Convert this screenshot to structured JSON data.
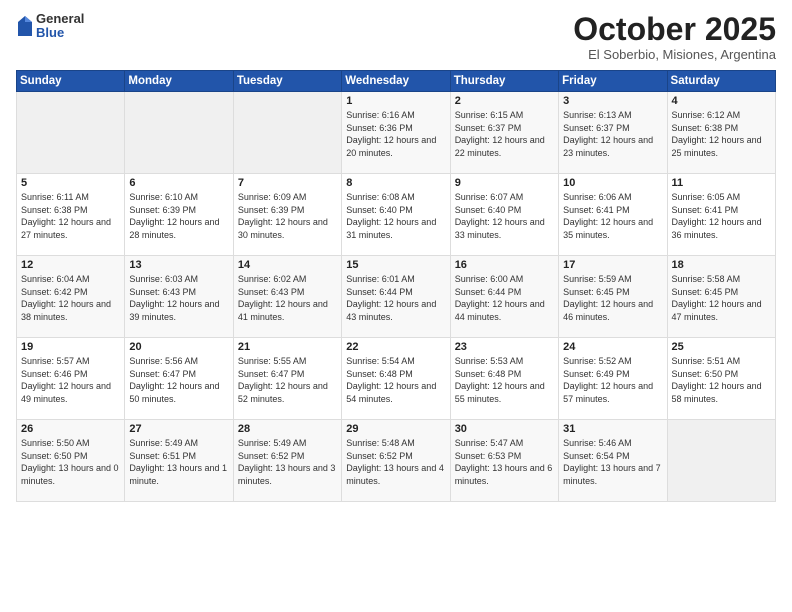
{
  "logo": {
    "general": "General",
    "blue": "Blue"
  },
  "header": {
    "month": "October 2025",
    "location": "El Soberbio, Misiones, Argentina"
  },
  "weekdays": [
    "Sunday",
    "Monday",
    "Tuesday",
    "Wednesday",
    "Thursday",
    "Friday",
    "Saturday"
  ],
  "weeks": [
    [
      {
        "day": "",
        "empty": true
      },
      {
        "day": "",
        "empty": true
      },
      {
        "day": "",
        "empty": true
      },
      {
        "day": "1",
        "sunrise": "6:16 AM",
        "sunset": "6:36 PM",
        "daylight": "12 hours and 20 minutes."
      },
      {
        "day": "2",
        "sunrise": "6:15 AM",
        "sunset": "6:37 PM",
        "daylight": "12 hours and 22 minutes."
      },
      {
        "day": "3",
        "sunrise": "6:13 AM",
        "sunset": "6:37 PM",
        "daylight": "12 hours and 23 minutes."
      },
      {
        "day": "4",
        "sunrise": "6:12 AM",
        "sunset": "6:38 PM",
        "daylight": "12 hours and 25 minutes."
      }
    ],
    [
      {
        "day": "5",
        "sunrise": "6:11 AM",
        "sunset": "6:38 PM",
        "daylight": "12 hours and 27 minutes."
      },
      {
        "day": "6",
        "sunrise": "6:10 AM",
        "sunset": "6:39 PM",
        "daylight": "12 hours and 28 minutes."
      },
      {
        "day": "7",
        "sunrise": "6:09 AM",
        "sunset": "6:39 PM",
        "daylight": "12 hours and 30 minutes."
      },
      {
        "day": "8",
        "sunrise": "6:08 AM",
        "sunset": "6:40 PM",
        "daylight": "12 hours and 31 minutes."
      },
      {
        "day": "9",
        "sunrise": "6:07 AM",
        "sunset": "6:40 PM",
        "daylight": "12 hours and 33 minutes."
      },
      {
        "day": "10",
        "sunrise": "6:06 AM",
        "sunset": "6:41 PM",
        "daylight": "12 hours and 35 minutes."
      },
      {
        "day": "11",
        "sunrise": "6:05 AM",
        "sunset": "6:41 PM",
        "daylight": "12 hours and 36 minutes."
      }
    ],
    [
      {
        "day": "12",
        "sunrise": "6:04 AM",
        "sunset": "6:42 PM",
        "daylight": "12 hours and 38 minutes."
      },
      {
        "day": "13",
        "sunrise": "6:03 AM",
        "sunset": "6:43 PM",
        "daylight": "12 hours and 39 minutes."
      },
      {
        "day": "14",
        "sunrise": "6:02 AM",
        "sunset": "6:43 PM",
        "daylight": "12 hours and 41 minutes."
      },
      {
        "day": "15",
        "sunrise": "6:01 AM",
        "sunset": "6:44 PM",
        "daylight": "12 hours and 43 minutes."
      },
      {
        "day": "16",
        "sunrise": "6:00 AM",
        "sunset": "6:44 PM",
        "daylight": "12 hours and 44 minutes."
      },
      {
        "day": "17",
        "sunrise": "5:59 AM",
        "sunset": "6:45 PM",
        "daylight": "12 hours and 46 minutes."
      },
      {
        "day": "18",
        "sunrise": "5:58 AM",
        "sunset": "6:45 PM",
        "daylight": "12 hours and 47 minutes."
      }
    ],
    [
      {
        "day": "19",
        "sunrise": "5:57 AM",
        "sunset": "6:46 PM",
        "daylight": "12 hours and 49 minutes."
      },
      {
        "day": "20",
        "sunrise": "5:56 AM",
        "sunset": "6:47 PM",
        "daylight": "12 hours and 50 minutes."
      },
      {
        "day": "21",
        "sunrise": "5:55 AM",
        "sunset": "6:47 PM",
        "daylight": "12 hours and 52 minutes."
      },
      {
        "day": "22",
        "sunrise": "5:54 AM",
        "sunset": "6:48 PM",
        "daylight": "12 hours and 54 minutes."
      },
      {
        "day": "23",
        "sunrise": "5:53 AM",
        "sunset": "6:48 PM",
        "daylight": "12 hours and 55 minutes."
      },
      {
        "day": "24",
        "sunrise": "5:52 AM",
        "sunset": "6:49 PM",
        "daylight": "12 hours and 57 minutes."
      },
      {
        "day": "25",
        "sunrise": "5:51 AM",
        "sunset": "6:50 PM",
        "daylight": "12 hours and 58 minutes."
      }
    ],
    [
      {
        "day": "26",
        "sunrise": "5:50 AM",
        "sunset": "6:50 PM",
        "daylight": "13 hours and 0 minutes."
      },
      {
        "day": "27",
        "sunrise": "5:49 AM",
        "sunset": "6:51 PM",
        "daylight": "13 hours and 1 minute."
      },
      {
        "day": "28",
        "sunrise": "5:49 AM",
        "sunset": "6:52 PM",
        "daylight": "13 hours and 3 minutes."
      },
      {
        "day": "29",
        "sunrise": "5:48 AM",
        "sunset": "6:52 PM",
        "daylight": "13 hours and 4 minutes."
      },
      {
        "day": "30",
        "sunrise": "5:47 AM",
        "sunset": "6:53 PM",
        "daylight": "13 hours and 6 minutes."
      },
      {
        "day": "31",
        "sunrise": "5:46 AM",
        "sunset": "6:54 PM",
        "daylight": "13 hours and 7 minutes."
      },
      {
        "day": "",
        "empty": true
      }
    ]
  ],
  "labels": {
    "sunrise": "Sunrise:",
    "sunset": "Sunset:",
    "daylight": "Daylight:"
  }
}
